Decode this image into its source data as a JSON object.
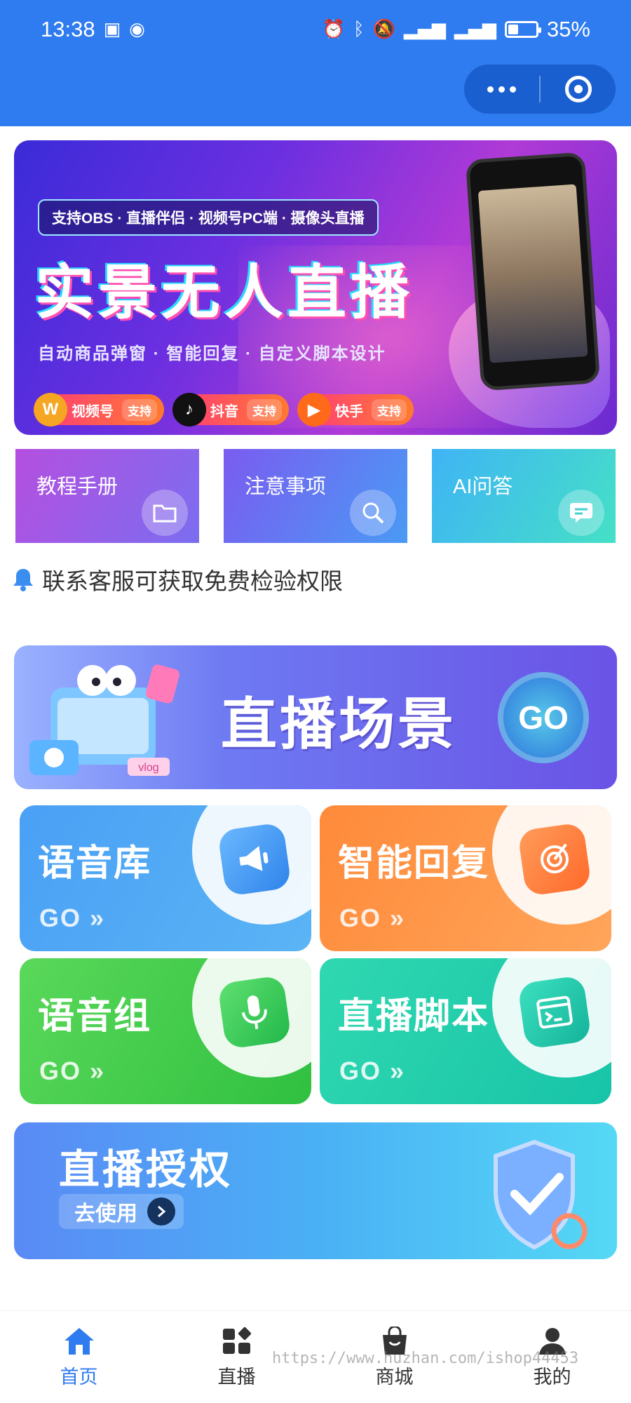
{
  "status_bar": {
    "time": "13:38",
    "battery_pct": "35%",
    "battery_level": 0.35
  },
  "banner": {
    "tag": "支持OBS · 直播伴侣 · 视频号PC端 · 摄像头直播",
    "title": "实景无人直播",
    "subtitle": "自动商品弹窗 · 智能回复 · 自定义脚本设计",
    "platforms": [
      {
        "name": "视频号",
        "support": "支持",
        "color": "#f5a623"
      },
      {
        "name": "抖音",
        "support": "支持",
        "color": "#111111"
      },
      {
        "name": "快手",
        "support": "支持",
        "color": "#ff6a1a"
      }
    ]
  },
  "tiles": [
    {
      "label": "教程手册",
      "icon": "folder-icon"
    },
    {
      "label": "注意事项",
      "icon": "search-icon"
    },
    {
      "label": "AI问答",
      "icon": "chat-icon"
    }
  ],
  "notice": {
    "text": "联系客服可获取免费检验权限",
    "icon": "bell-icon"
  },
  "scene_card": {
    "title": "直播场景",
    "go": "GO",
    "art_badge": "vlog"
  },
  "grid": [
    {
      "name": "语音库",
      "go": "GO »",
      "icon": "megaphone-icon"
    },
    {
      "name": "智能回复",
      "go": "GO »",
      "icon": "target-icon"
    },
    {
      "name": "语音组",
      "go": "GO »",
      "icon": "microphone-icon"
    },
    {
      "name": "直播脚本",
      "go": "GO »",
      "icon": "terminal-icon"
    }
  ],
  "auth_card": {
    "title": "直播授权",
    "button": "去使用"
  },
  "tabbar": [
    {
      "label": "首页",
      "icon": "home-icon",
      "active": true
    },
    {
      "label": "直播",
      "icon": "apps-icon",
      "active": false
    },
    {
      "label": "商城",
      "icon": "shopping-bag-icon",
      "active": false
    },
    {
      "label": "我的",
      "icon": "user-icon",
      "active": false
    }
  ],
  "watermark": "https://www.huzhan.com/ishop44453",
  "colors": {
    "primary": "#2f7bf0",
    "tab_active": "#2f7bf0",
    "tab_inactive": "#333333"
  }
}
